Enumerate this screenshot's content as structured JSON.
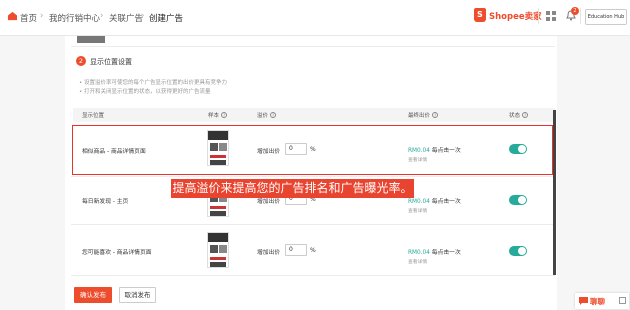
{
  "breadcrumb": [
    "首页",
    "我的行销中心",
    "关联广告",
    "创建广告"
  ],
  "brand": {
    "logo_text": "Shopee卖家",
    "accent": "#ee4d2d"
  },
  "header": {
    "notification_count": "2",
    "account_name": "Education Hub"
  },
  "section": {
    "number": "2",
    "title": "显示位置设置",
    "notes": [
      "• 设置溢价率可使您的每个广告显示位置的出价更具有竞争力",
      "• 打开和关闭显示位置的状态，以获得更好的广告流量"
    ]
  },
  "table": {
    "columns": {
      "position": "显示位置",
      "sample": "样本",
      "premium": "溢价",
      "final_bid": "最终出价",
      "status": "状态"
    },
    "rows": [
      {
        "position": "相似商品 - 商品详情页面",
        "premium_label": "增加出价",
        "premium_value": "0",
        "premium_unit": "%",
        "bid_amount": "RM0.04",
        "bid_unit": " 每点击一次",
        "detail_link": "查看详情",
        "status_on": true
      },
      {
        "position": "每日新发现 - 主页",
        "premium_label": "增加出价",
        "premium_value": "0",
        "premium_unit": "%",
        "bid_amount": "RM0.04",
        "bid_unit": " 每点击一次",
        "detail_link": "查看详情",
        "status_on": true
      },
      {
        "position": "您可能喜欢 - 商品详情页面",
        "premium_label": "增加出价",
        "premium_value": "0",
        "premium_unit": "%",
        "bid_amount": "RM0.04",
        "bid_unit": " 每点击一次",
        "detail_link": "查看详情",
        "status_on": true
      }
    ]
  },
  "callout": "提高溢价来提高您的广告排名和广告曝光率。",
  "buttons": {
    "publish": "确认发布",
    "cancel": "取消发布"
  },
  "chat": {
    "label": "聊聊"
  },
  "colors": {
    "toggle_on": "#26aa99",
    "highlight": "#e8332a"
  }
}
